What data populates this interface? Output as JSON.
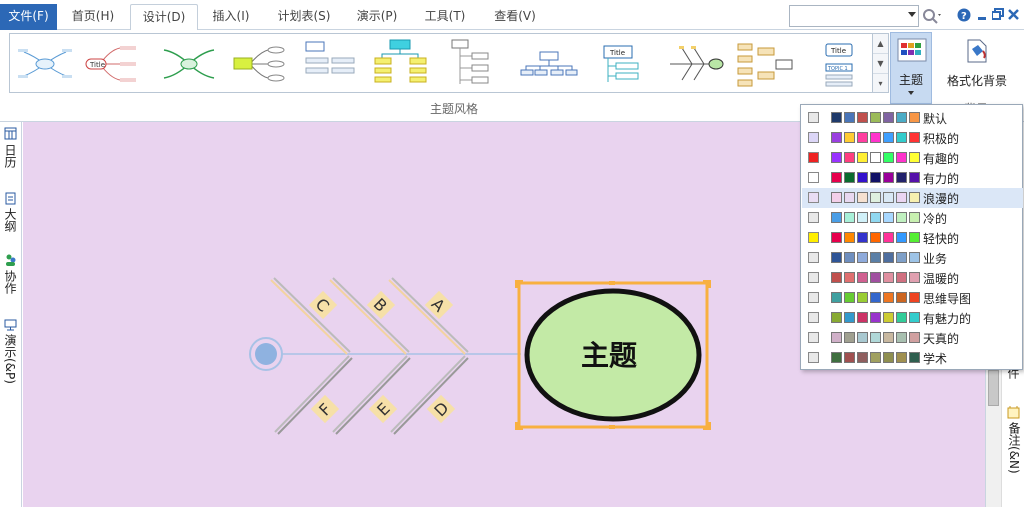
{
  "menu": {
    "file": "文件(F)",
    "tabs": [
      "首页(H)",
      "设计(D)",
      "插入(I)",
      "计划表(S)",
      "演示(P)",
      "工具(T)",
      "查看(V)"
    ],
    "active_index": 1
  },
  "ribbon": {
    "theme_label": "主题",
    "background_label": "格式化背景",
    "group_label": "主题风格",
    "group_label_2": "背景",
    "thumb_title": "Title",
    "thumb_topic": "TOPIC 1"
  },
  "left_panel": [
    "日历",
    "大纲",
    "协作",
    "演示(&P)"
  ],
  "right_panel": [
    "附件",
    "备注(&N)"
  ],
  "diagram": {
    "main_topic": "主题",
    "upper_ribs": [
      "C",
      "B",
      "A"
    ],
    "lower_ribs": [
      "F",
      "E",
      "D"
    ]
  },
  "themes": [
    {
      "name": "默认",
      "check": "#e8e8e8",
      "colors": [
        "#1f3a6b",
        "#4a76b9",
        "#c0504d",
        "#9bbb59",
        "#8064a2",
        "#4bacc6",
        "#f79646"
      ]
    },
    {
      "name": "积极的",
      "check": "#dcd6f7",
      "colors": [
        "#9a3fe0",
        "#ffcc33",
        "#ff3fa0",
        "#ff33cc",
        "#3fa0ff",
        "#33cccc",
        "#ff3333"
      ]
    },
    {
      "name": "有趣的",
      "check": "#ee2222",
      "colors": [
        "#9933ff",
        "#ff3f7f",
        "#ffee33",
        "#ffffff",
        "#33ff66",
        "#ff33cc",
        "#ffff33"
      ]
    },
    {
      "name": "有力的",
      "check": "#ffffff",
      "colors": [
        "#e6004c",
        "#0a6b2e",
        "#3311cc",
        "#111166",
        "#990099",
        "#22226b",
        "#5511aa"
      ]
    },
    {
      "name": "浪漫的",
      "check": "#e9ddf3",
      "colors": [
        "#f3cfe9",
        "#e8d8f0",
        "#f5e0d0",
        "#dff0df",
        "#d9e8f5",
        "#ead5f2",
        "#f7f0b0"
      ]
    },
    {
      "name": "冷的",
      "check": "#e8e8e8",
      "colors": [
        "#4a9ee6",
        "#a8f0d8",
        "#d0f0f8",
        "#90d8f0",
        "#a8d8ff",
        "#c0f0c0",
        "#c8f0b0"
      ]
    },
    {
      "name": "轻快的",
      "check": "#ffee00",
      "colors": [
        "#e6004c",
        "#ff8800",
        "#3333cc",
        "#ff6600",
        "#ff3399",
        "#3399ff",
        "#55ee33"
      ]
    },
    {
      "name": "业务",
      "check": "#e8e8e8",
      "colors": [
        "#2f5597",
        "#6f8fbf",
        "#8eaadb",
        "#5b7fa6",
        "#4f6f9f",
        "#7fa0c8",
        "#9dc3e6"
      ]
    },
    {
      "name": "温暖的",
      "check": "#e8e8e8",
      "colors": [
        "#c0504d",
        "#e07070",
        "#d06090",
        "#a050a0",
        "#e090a0",
        "#d07080",
        "#e0a0b0"
      ]
    },
    {
      "name": "思维导图",
      "check": "#e8e8e8",
      "colors": [
        "#3fa0a0",
        "#66cc33",
        "#99cc33",
        "#3366cc",
        "#ee7722",
        "#cc6622",
        "#ee4422"
      ]
    },
    {
      "name": "有魅力的",
      "check": "#e8e8e8",
      "colors": [
        "#88aa33",
        "#3399cc",
        "#cc3366",
        "#9933cc",
        "#cccc33",
        "#33cc99",
        "#33cccc"
      ]
    },
    {
      "name": "天真的",
      "check": "#e8e8e8",
      "colors": [
        "#d0b0c8",
        "#a0a090",
        "#a8c8d0",
        "#b0d8d8",
        "#c8b8a0",
        "#a8c0b0",
        "#d0a0a0"
      ]
    },
    {
      "name": "学术",
      "check": "#e8e8e8",
      "colors": [
        "#3f6f3f",
        "#a05050",
        "#8f5f5f",
        "#a0a060",
        "#8f8f50",
        "#a09050",
        "#2f5f4f"
      ]
    }
  ]
}
